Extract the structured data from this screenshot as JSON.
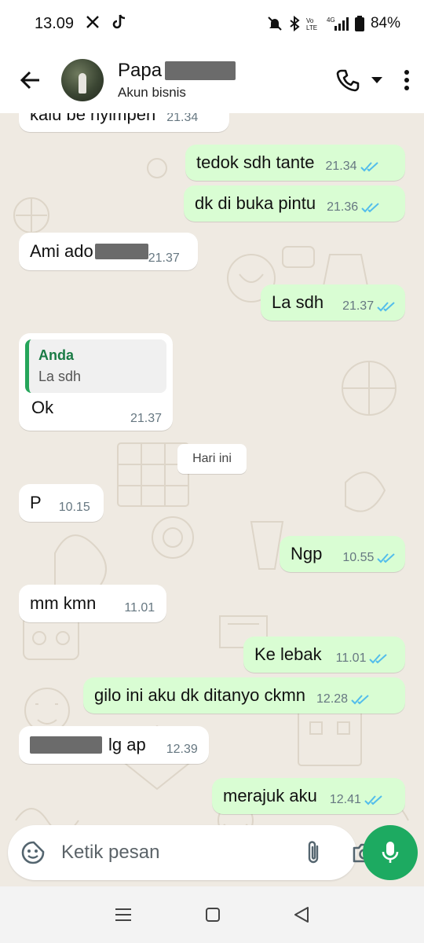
{
  "status_bar": {
    "time": "13.09",
    "battery": "84%"
  },
  "header": {
    "contact_name": "Papa",
    "subtitle": "Akun bisnis"
  },
  "messages": [
    {
      "id": 0,
      "dir": "in",
      "text": "kalu be nyimpen",
      "time": "21.34"
    },
    {
      "id": 1,
      "dir": "out",
      "text": "tedok sdh tante",
      "time": "21.34"
    },
    {
      "id": 2,
      "dir": "out",
      "text": "dk di buka pintu",
      "time": "21.36"
    },
    {
      "id": 3,
      "dir": "in",
      "text": "Ami ado",
      "time": "21.37"
    },
    {
      "id": 4,
      "dir": "out",
      "text": "La sdh",
      "time": "21.37"
    },
    {
      "id": 5,
      "dir": "in",
      "text": "Ok",
      "time": "21.37",
      "quote_author": "Anda",
      "quote_text": "La sdh"
    },
    {
      "id": 6,
      "dir": "in",
      "text": "P",
      "time": "10.15"
    },
    {
      "id": 7,
      "dir": "out",
      "text": "Ngp",
      "time": "10.55"
    },
    {
      "id": 8,
      "dir": "in",
      "text": "mm kmn",
      "time": "11.01"
    },
    {
      "id": 9,
      "dir": "out",
      "text": "Ke lebak",
      "time": "11.01"
    },
    {
      "id": 10,
      "dir": "out",
      "text": "gilo ini aku dk ditanyo ckmn",
      "time": "12.28"
    },
    {
      "id": 11,
      "dir": "in",
      "text": "lg ap",
      "time": "12.39"
    },
    {
      "id": 12,
      "dir": "out",
      "text": "merajuk aku",
      "time": "12.41"
    }
  ],
  "date_chip": "Hari ini",
  "composer": {
    "placeholder": "Ketik pesan"
  },
  "icons": {
    "back": "arrow-left-icon",
    "call": "phone-icon",
    "dropdown": "caret-down-icon",
    "menu": "more-vertical-icon",
    "sticker": "sticker-icon",
    "attach": "paperclip-icon",
    "camera": "camera-icon",
    "mic": "mic-icon",
    "read_receipt": "double-check-icon"
  },
  "colors": {
    "chat_background": "#efeae2",
    "outgoing_bubble": "#d9fdd3",
    "incoming_bubble": "#ffffff",
    "read_tick": "#53bdeb",
    "accent_green": "#1daa61",
    "quote_bar": "#25a55a"
  }
}
